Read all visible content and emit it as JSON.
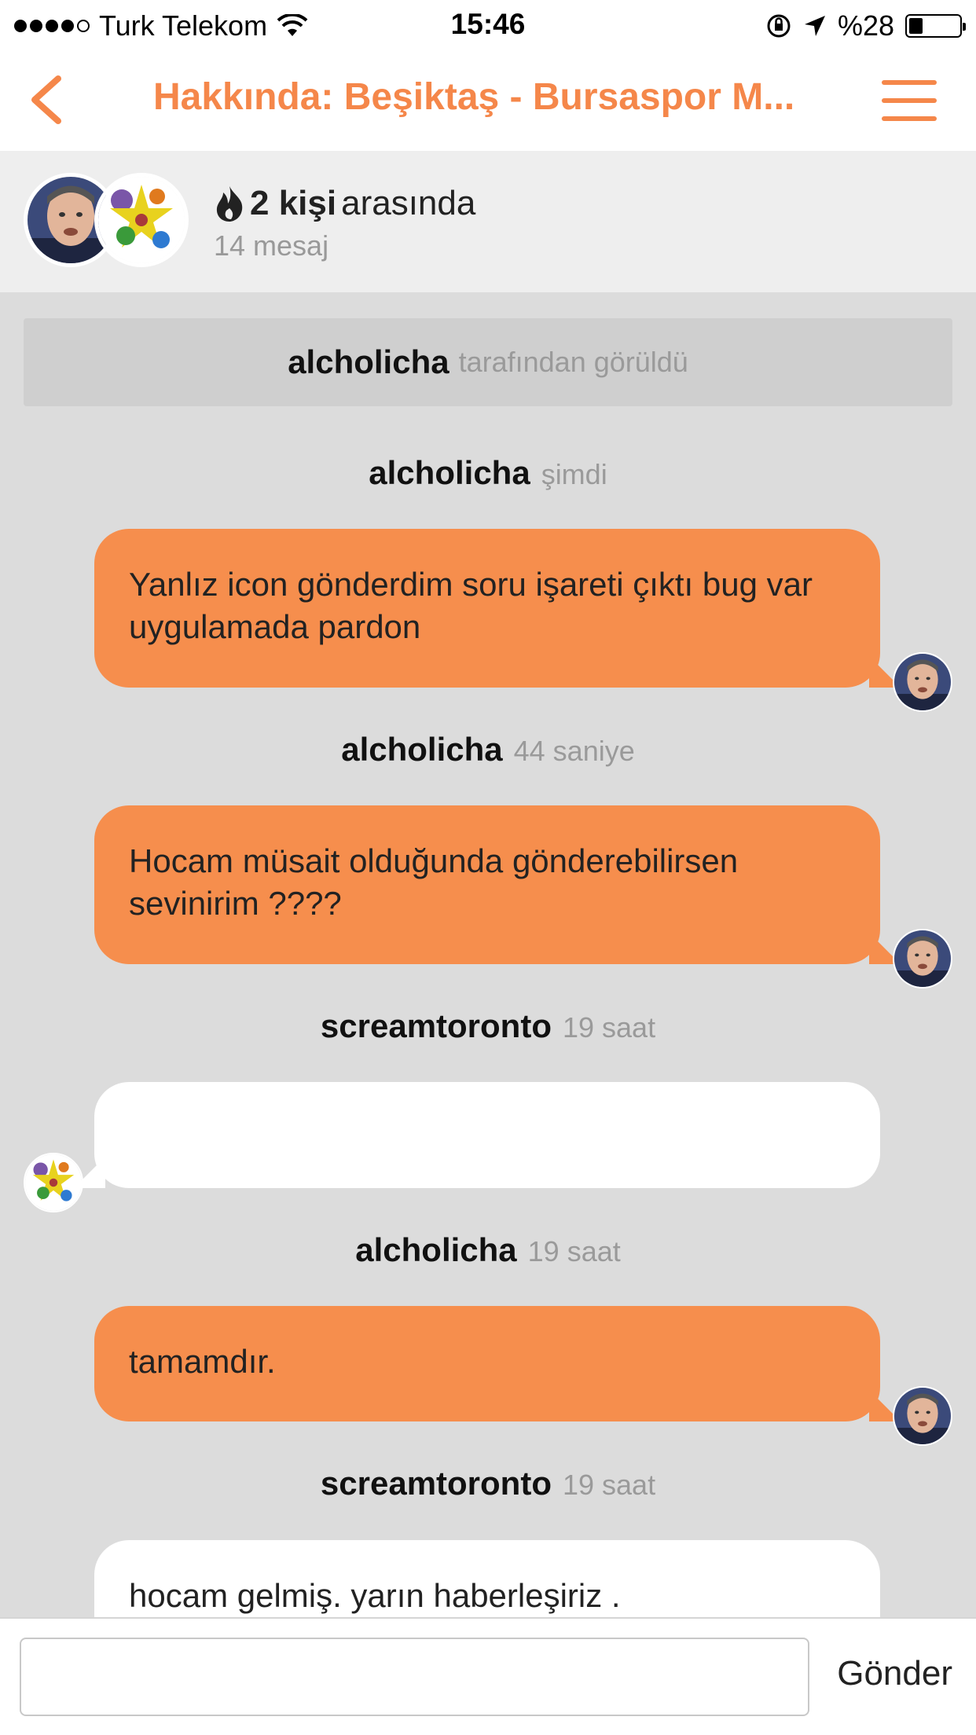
{
  "status_bar": {
    "carrier": "Turk Telekom",
    "time": "15:46",
    "battery": "%28",
    "battery_level": 0.28
  },
  "nav": {
    "title": "Hakkında: Beşiktaş - Bursaspor M..."
  },
  "participants": {
    "count": "2 kişi",
    "between": "arasında",
    "messages": "14 mesaj"
  },
  "seen": {
    "user": "alcholicha",
    "text": "tarafından görüldü"
  },
  "messages": [
    {
      "user": "alcholicha",
      "time": "şimdi",
      "text": "Yanlız icon gönderdim soru işareti çıktı bug var uygulamada pardon",
      "from_me": true
    },
    {
      "user": "alcholicha",
      "time": "44 saniye",
      "text": "Hocam müsait olduğunda gönderebilirsen sevinirim ????",
      "from_me": true
    },
    {
      "user": "screamtoronto",
      "time": "19 saat",
      "text": "",
      "from_me": false
    },
    {
      "user": "alcholicha",
      "time": "19 saat",
      "text": "tamamdır.",
      "from_me": true
    },
    {
      "user": "screamtoronto",
      "time": "19 saat",
      "text": "hocam gelmiş. yarın haberleşiriz .",
      "from_me": false
    }
  ],
  "input": {
    "placeholder": "",
    "send_label": "Gönder"
  },
  "colors": {
    "accent": "#f5874a",
    "bubble_me": "#f68e4d",
    "bubble_them": "#ffffff",
    "background": "#dcdcdc"
  }
}
